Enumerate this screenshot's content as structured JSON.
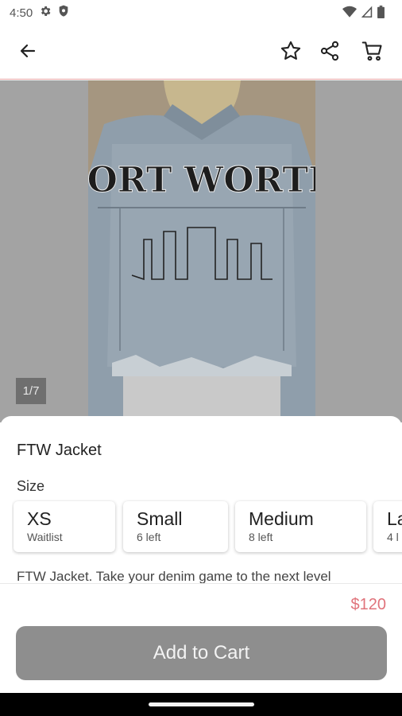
{
  "status_bar": {
    "time": "4:50"
  },
  "app_bar": {
    "back_icon": "arrow-left-icon",
    "favorite_icon": "star-outline-icon",
    "share_icon": "share-icon",
    "cart_icon": "cart-icon"
  },
  "gallery": {
    "counter": "1/7",
    "image_text": "FORT WORTH"
  },
  "product": {
    "title": "FTW Jacket",
    "size_label": "Size",
    "sizes": [
      {
        "name": "XS",
        "stock": "Waitlist"
      },
      {
        "name": "Small",
        "stock": "6 left"
      },
      {
        "name": "Medium",
        "stock": "8 left"
      },
      {
        "name": "La",
        "stock": "4 l"
      }
    ],
    "description": "FTW Jacket. Take your denim game to the next level",
    "price": "$120"
  },
  "actions": {
    "add_to_cart": "Add to Cart"
  },
  "colors": {
    "price": "#e0737b",
    "button_bg": "#8e8e8e",
    "divider_accent": "#e7a3a3"
  }
}
